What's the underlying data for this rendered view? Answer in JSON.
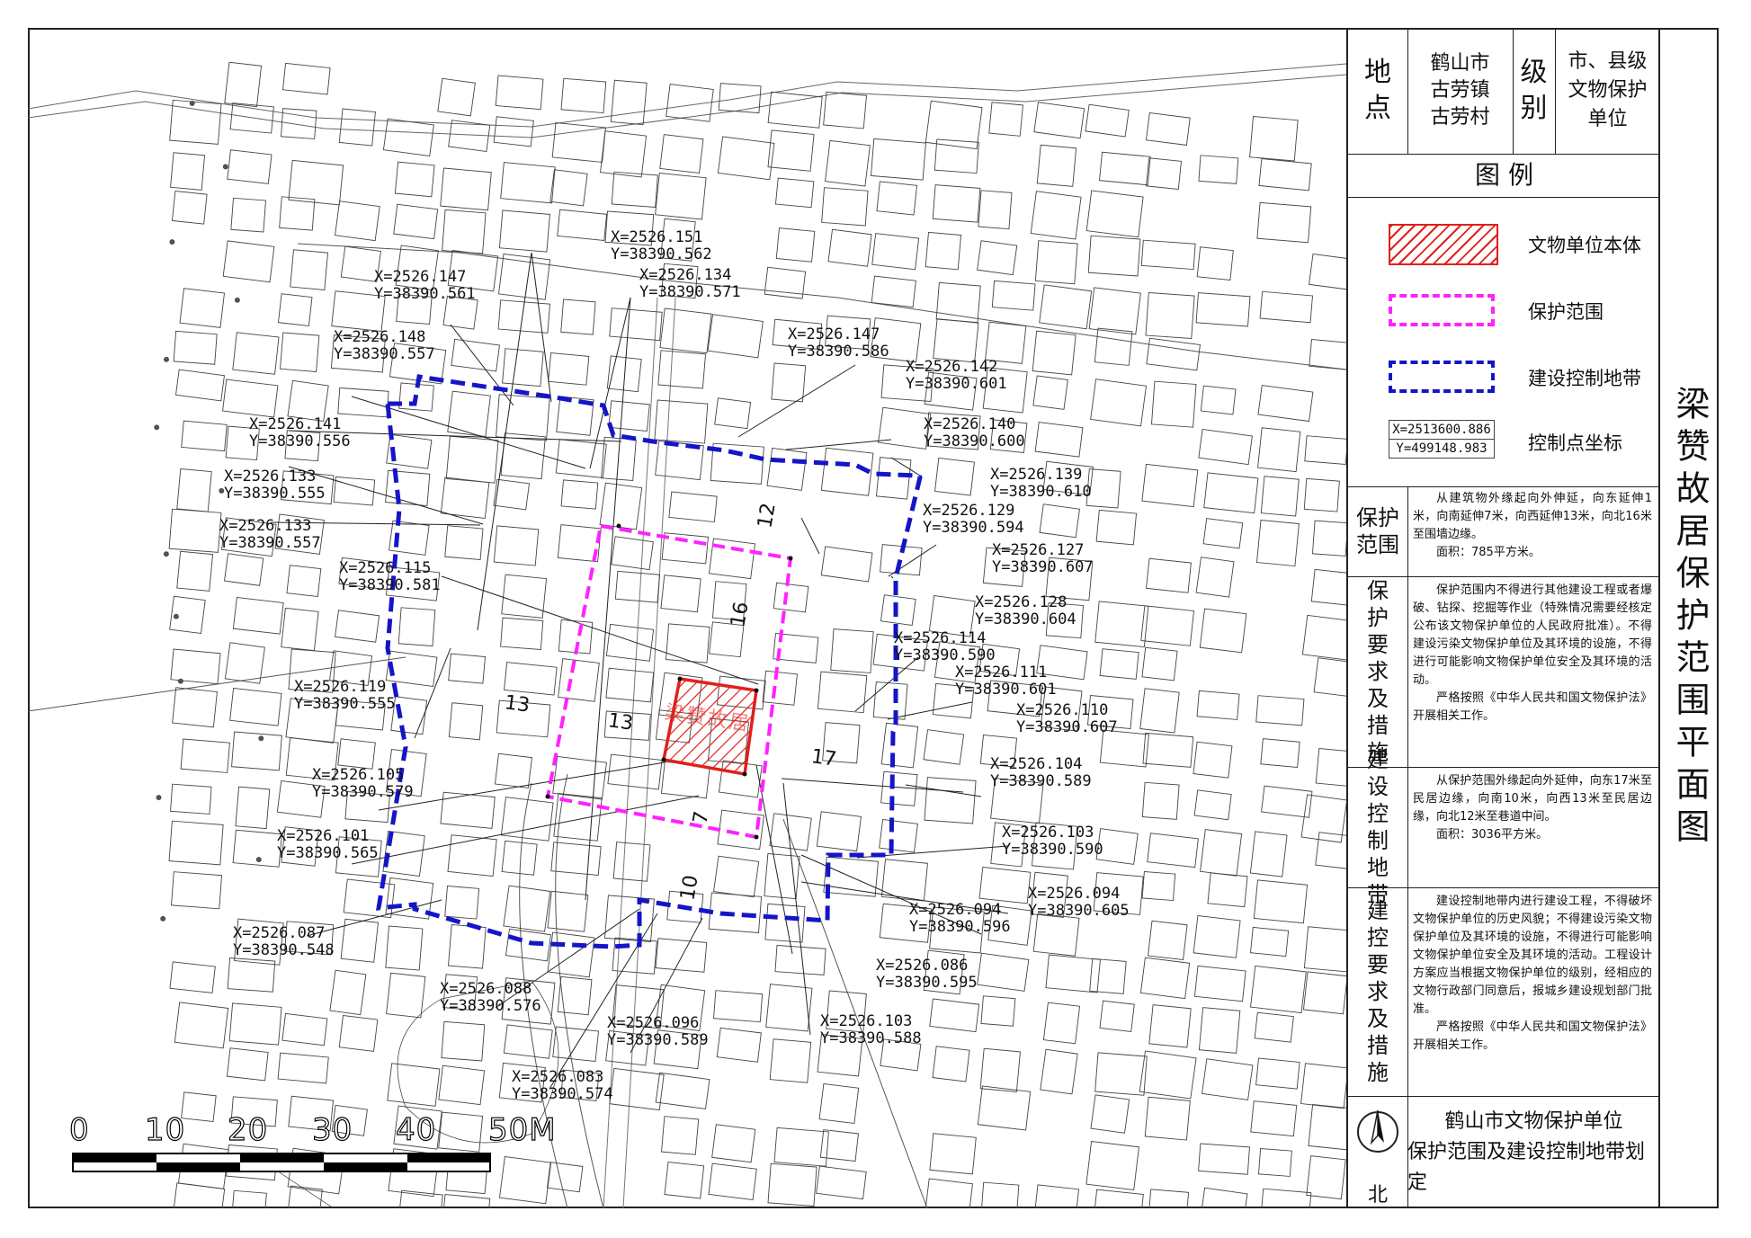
{
  "header": {
    "location_label": "地点",
    "location_value": "鹤山市古劳镇古劳村",
    "grade_label": "级别",
    "grade_value": "市、县级文物保护单位"
  },
  "legend": {
    "title": "图 例",
    "items": [
      {
        "label": "文物单位本体"
      },
      {
        "label": "保护范围"
      },
      {
        "label": "建设控制地带"
      },
      {
        "label": "控制点坐标",
        "sample_x": "X=2513600.886",
        "sample_y": "Y=499148.983"
      }
    ]
  },
  "sections": [
    {
      "label": "保护范围",
      "paragraphs": [
        "从建筑物外缘起向外伸延，向东延伸1米，向南延伸7米，向西延伸13米，向北16米至围墙边缘。",
        "面积：785平方米。"
      ]
    },
    {
      "label": "保护要求及措施",
      "paragraphs": [
        "保护范围内不得进行其他建设工程或者爆破、钻探、挖掘等作业（特殊情况需要经核定公布该文物保护单位的人民政府批准）。不得建设污染文物保护单位及其环境的设施，不得进行可能影响文物保护单位安全及其环境的活动。",
        "严格按照《中华人民共和国文物保护法》开展相关工作。"
      ]
    },
    {
      "label": "建设控制地带",
      "paragraphs": [
        "从保护范围外缘起向外延伸，向东17米至民居边缘，向南10米，向西13米至民居边缘，向北12米至巷道中间。",
        "面积：3036平方米。"
      ]
    },
    {
      "label": "建控要求及措施",
      "paragraphs": [
        "建设控制地带内进行建设工程，不得破坏文物保护单位的历史风貌；不得建设污染文物保护单位及其环境的设施，不得进行可能影响文物保护单位安全及其环境的活动。工程设计方案应当根据文物保护单位的级别，经相应的文物行政部门同意后，报城乡建设规划部门批准。",
        "严格按照《中华人民共和国文物保护法》开展相关工作。"
      ]
    }
  ],
  "footer": {
    "north_label": "北",
    "org_line1": "鹤山市文物保护单位",
    "org_line2": "保护范围及建设控制地带划定"
  },
  "title": "梁赞故居保护范围平面图",
  "map": {
    "site_name": "梁赞故居",
    "colors": {
      "site": "#e0201b",
      "protection": "#ff22ff",
      "control": "#1515c8"
    },
    "scale_labels": [
      "0",
      "10",
      "20",
      "30",
      "40",
      "50M"
    ],
    "distance_labels": [
      "12",
      "16",
      "13",
      "13",
      "17",
      "7",
      "10"
    ],
    "control_points": [
      {
        "x": "X=2526.151",
        "y": "Y=38390.562"
      },
      {
        "x": "X=2526.134",
        "y": "Y=38390.571"
      },
      {
        "x": "X=2526.147",
        "y": "Y=38390.561"
      },
      {
        "x": "X=2526.147",
        "y": "Y=38390.586"
      },
      {
        "x": "X=2526.148",
        "y": "Y=38390.557"
      },
      {
        "x": "X=2526.142",
        "y": "Y=38390.601"
      },
      {
        "x": "X=2526.141",
        "y": "Y=38390.556"
      },
      {
        "x": "X=2526.140",
        "y": "Y=38390.600"
      },
      {
        "x": "X=2526.133",
        "y": "Y=38390.555"
      },
      {
        "x": "X=2526.139",
        "y": "Y=38390.610"
      },
      {
        "x": "X=2526.133",
        "y": "Y=38390.557"
      },
      {
        "x": "X=2526.129",
        "y": "Y=38390.594"
      },
      {
        "x": "X=2526.127",
        "y": "Y=38390.607"
      },
      {
        "x": "X=2526.115",
        "y": "Y=38390.581"
      },
      {
        "x": "X=2526.128",
        "y": "Y=38390.604"
      },
      {
        "x": "X=2526.114",
        "y": "Y=38390.590"
      },
      {
        "x": "X=2526.119",
        "y": "Y=38390.555"
      },
      {
        "x": "X=2526.111",
        "y": "Y=38390.601"
      },
      {
        "x": "X=2526.110",
        "y": "Y=38390.607"
      },
      {
        "x": "X=2526.105",
        "y": "Y=38390.579"
      },
      {
        "x": "X=2526.104",
        "y": "Y=38390.589"
      },
      {
        "x": "X=2526.101",
        "y": "Y=38390.565"
      },
      {
        "x": "X=2526.103",
        "y": "Y=38390.590"
      },
      {
        "x": "X=2526.094",
        "y": "Y=38390.605"
      },
      {
        "x": "X=2526.094",
        "y": "Y=38390.596"
      },
      {
        "x": "X=2526.087",
        "y": "Y=38390.548"
      },
      {
        "x": "X=2526.086",
        "y": "Y=38390.595"
      },
      {
        "x": "X=2526.088",
        "y": "Y=38390.576"
      },
      {
        "x": "X=2526.096",
        "y": "Y=38390.589"
      },
      {
        "x": "X=2526.103",
        "y": "Y=38390.588"
      },
      {
        "x": "X=2526.083",
        "y": "Y=38390.574"
      }
    ]
  }
}
